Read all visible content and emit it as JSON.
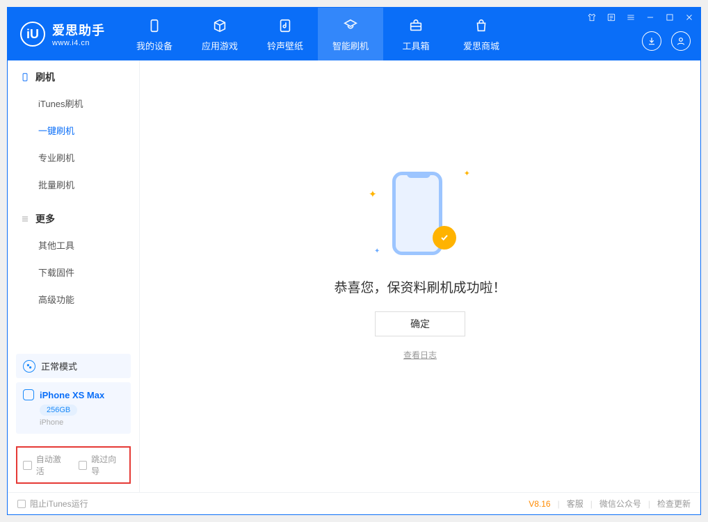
{
  "app": {
    "name": "爱思助手",
    "url": "www.i4.cn"
  },
  "tabs": [
    {
      "label": "我的设备",
      "icon": "device"
    },
    {
      "label": "应用游戏",
      "icon": "cube"
    },
    {
      "label": "铃声壁纸",
      "icon": "music"
    },
    {
      "label": "智能刷机",
      "icon": "refresh",
      "active": true
    },
    {
      "label": "工具箱",
      "icon": "toolbox"
    },
    {
      "label": "爱思商城",
      "icon": "shop"
    }
  ],
  "sidebar": {
    "sections": [
      {
        "title": "刷机",
        "items": [
          "iTunes刷机",
          "一键刷机",
          "专业刷机",
          "批量刷机"
        ],
        "activeIndex": 1,
        "icon": "device"
      },
      {
        "title": "更多",
        "items": [
          "其他工具",
          "下载固件",
          "高级功能"
        ],
        "icon": "menu"
      }
    ],
    "mode": "正常模式",
    "device": {
      "name": "iPhone XS Max",
      "capacity": "256GB",
      "sub": "iPhone"
    },
    "checks": {
      "autoActivate": "自动激活",
      "skipGuide": "跳过向导"
    }
  },
  "main": {
    "headline": "恭喜您，保资料刷机成功啦！",
    "okButton": "确定",
    "viewLog": "查看日志"
  },
  "footer": {
    "blockItunes": "阻止iTunes运行",
    "version": "V8.16",
    "links": [
      "客服",
      "微信公众号",
      "检查更新"
    ]
  }
}
